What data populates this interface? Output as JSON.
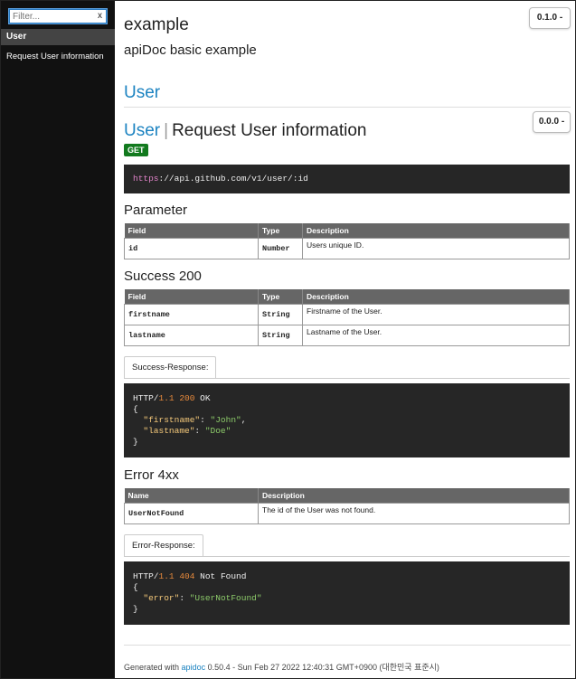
{
  "sidebar": {
    "filter_placeholder": "Filter...",
    "filter_clear": "x",
    "group_header": "User",
    "items": [
      {
        "label": "Request User information"
      }
    ]
  },
  "project": {
    "name": "example",
    "description": "apiDoc basic example",
    "version_label": "0.1.0 -"
  },
  "group": {
    "title": "User"
  },
  "api": {
    "group": "User",
    "separator": "|",
    "title": "Request User information",
    "version_label": "0.0.0 -",
    "method": "GET",
    "url_scheme": "https",
    "url_rest": "://api.github.com/v1/user/:id"
  },
  "parameter": {
    "title": "Parameter",
    "headers": [
      "Field",
      "Type",
      "Description"
    ],
    "rows": [
      {
        "field": "id",
        "type": "Number",
        "description": "Users unique ID."
      }
    ]
  },
  "success": {
    "title": "Success 200",
    "headers": [
      "Field",
      "Type",
      "Description"
    ],
    "rows": [
      {
        "field": "firstname",
        "type": "String",
        "description": "Firstname of the User."
      },
      {
        "field": "lastname",
        "type": "String",
        "description": "Lastname of the User."
      }
    ],
    "tab_label": "Success-Response:",
    "code": {
      "http": "HTTP/",
      "version": "1.1",
      "status": "200",
      "status_text": " OK",
      "open": "{",
      "k1": "\"firstname\"",
      "v1": "\"John\"",
      "k2": "\"lastname\"",
      "v2": "\"Doe\"",
      "close": "}"
    }
  },
  "error": {
    "title": "Error 4xx",
    "headers": [
      "Name",
      "Description"
    ],
    "rows": [
      {
        "name": "UserNotFound",
        "description": "The id of the User was not found."
      }
    ],
    "tab_label": "Error-Response:",
    "code": {
      "http": "HTTP/",
      "version": "1.1",
      "status": "404",
      "status_text": " Not Found",
      "open": "{",
      "k1": "\"error\"",
      "v1": "\"UserNotFound\"",
      "close": "}"
    }
  },
  "footer": {
    "prefix": "Generated with ",
    "link": "apidoc",
    "suffix": " 0.50.4 - Sun Feb 27 2022 12:40:31 GMT+0900 (대한민국 표준시)"
  },
  "colors": {
    "accent": "#1c83c1",
    "get_badge": "#127a1e",
    "sidebar_bg": "#111111",
    "code_bg": "#262626"
  }
}
